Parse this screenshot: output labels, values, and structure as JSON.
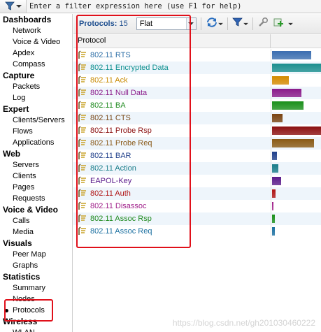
{
  "filter": {
    "placeholder": "Enter a filter expression here (use F1 for help)"
  },
  "sidebar": {
    "sections": [
      {
        "label": "Dashboards",
        "items": [
          {
            "label": "Network"
          },
          {
            "label": "Voice & Video"
          },
          {
            "label": "Apdex"
          },
          {
            "label": "Compass"
          }
        ]
      },
      {
        "label": "Capture",
        "items": [
          {
            "label": "Packets"
          },
          {
            "label": "Log"
          }
        ]
      },
      {
        "label": "Expert",
        "items": [
          {
            "label": "Clients/Servers"
          },
          {
            "label": "Flows"
          },
          {
            "label": "Applications"
          }
        ]
      },
      {
        "label": "Web",
        "items": [
          {
            "label": "Servers"
          },
          {
            "label": "Clients"
          },
          {
            "label": "Pages"
          },
          {
            "label": "Requests"
          }
        ]
      },
      {
        "label": "Voice & Video",
        "items": [
          {
            "label": "Calls"
          },
          {
            "label": "Media"
          }
        ]
      },
      {
        "label": "Visuals",
        "items": [
          {
            "label": "Peer Map"
          },
          {
            "label": "Graphs"
          }
        ]
      },
      {
        "label": "Statistics",
        "items": [
          {
            "label": "Summary"
          },
          {
            "label": "Nodes"
          },
          {
            "label": "Protocols",
            "active": true
          }
        ]
      },
      {
        "label": "Wireless",
        "items": [
          {
            "label": "WLAN"
          }
        ]
      }
    ]
  },
  "toolbar": {
    "count_label": "Protocols:",
    "count_value": "15",
    "view_value": "Flat"
  },
  "table": {
    "column_header": "Protocol",
    "rows": [
      {
        "name": "802.11 RTS",
        "color": "#2e6fa7",
        "bar_color": "#3a6db0",
        "bar_fraction": 0.8
      },
      {
        "name": "802.11 Encrypted Data",
        "color": "#0d8f8f",
        "bar_color": "#1b8e8e",
        "bar_fraction": 1.0
      },
      {
        "name": "802.11 Ack",
        "color": "#c88a00",
        "bar_color": "#d48a00",
        "bar_fraction": 0.34
      },
      {
        "name": "802.11 Null Data",
        "color": "#8a1a8a",
        "bar_color": "#8a1a8a",
        "bar_fraction": 0.6
      },
      {
        "name": "802.11 BA",
        "color": "#1f8a1f",
        "bar_color": "#1a8f1a",
        "bar_fraction": 0.64
      },
      {
        "name": "802.11 CTS",
        "color": "#7a4a1a",
        "bar_color": "#7a4310",
        "bar_fraction": 0.22
      },
      {
        "name": "802.11 Probe Rsp",
        "color": "#8b1010",
        "bar_color": "#8b0f0f",
        "bar_fraction": 1.0
      },
      {
        "name": "802.11 Probe Req",
        "color": "#8a5a1a",
        "bar_color": "#8a5a14",
        "bar_fraction": 0.86
      },
      {
        "name": "802.11 BAR",
        "color": "#1f3f8a",
        "bar_color": "#1f3f8a",
        "bar_fraction": 0.1
      },
      {
        "name": "802.11 Action",
        "color": "#1a7d8a",
        "bar_color": "#1a7d8a",
        "bar_fraction": 0.13
      },
      {
        "name": "EAPOL-Key",
        "color": "#5a1a8a",
        "bar_color": "#5a1a8a",
        "bar_fraction": 0.18
      },
      {
        "name": "802.11 Auth",
        "color": "#b01515",
        "bar_color": "#b01515",
        "bar_fraction": 0.07
      },
      {
        "name": "802.11 Disassoc",
        "color": "#a0208a",
        "bar_color": "#a0208a",
        "bar_fraction": 0.03
      },
      {
        "name": "802.11 Assoc Rsp",
        "color": "#1f8a1f",
        "bar_color": "#1a8f1a",
        "bar_fraction": 0.06
      },
      {
        "name": "802.11 Assoc Req",
        "color": "#1a6fa0",
        "bar_color": "#1a6fa0",
        "bar_fraction": 0.06
      }
    ]
  },
  "watermark": "https://blog.csdn.net/gh201030460222"
}
